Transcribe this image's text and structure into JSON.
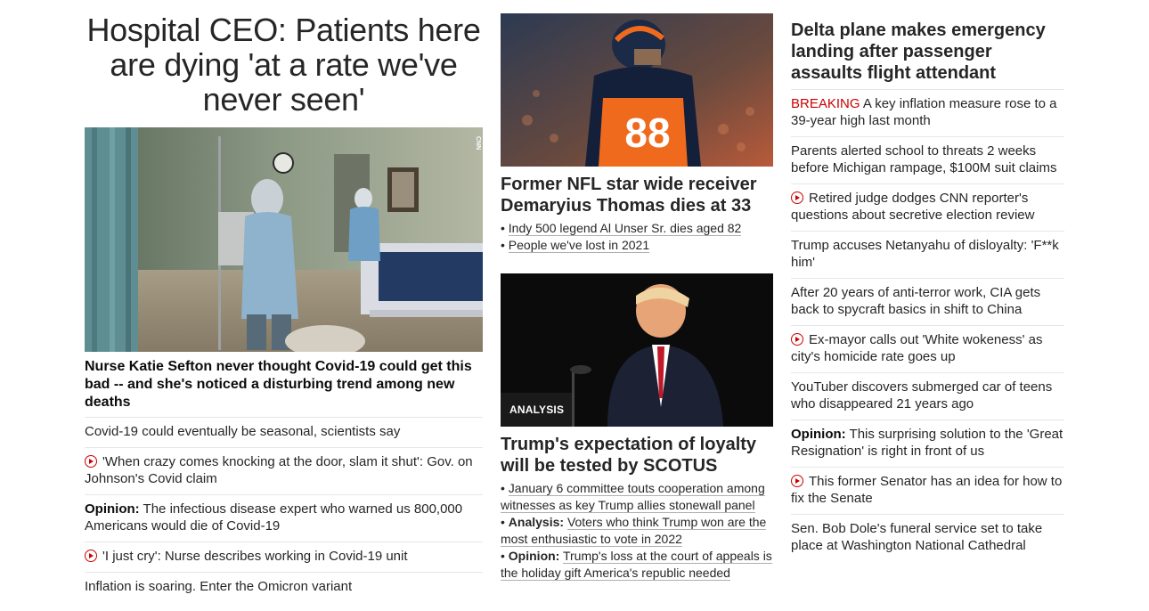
{
  "hero": {
    "title": "Hospital CEO: Patients here are dying 'at a rate we've never seen'",
    "watermark": "CNN",
    "caption": "Nurse Katie Sefton never thought Covid-19 could get this bad -- and she's noticed a disturbing trend among new deaths"
  },
  "col1_list": [
    {
      "video": false,
      "prefix": "",
      "text": "Covid-19 could eventually be seasonal, scientists say"
    },
    {
      "video": true,
      "prefix": "",
      "text": "'When crazy comes knocking at the door, slam it shut': Gov. on Johnson's Covid claim"
    },
    {
      "video": false,
      "prefix": "Opinion:",
      "text": " The infectious disease expert who warned us 800,000 Americans would die of Covid-19"
    },
    {
      "video": true,
      "prefix": "",
      "text": "'I just cry': Nurse describes working in Covid-19 unit"
    },
    {
      "video": false,
      "prefix": "",
      "text": "Inflation is soaring. Enter the Omicron variant"
    }
  ],
  "nfl": {
    "title": "Former NFL star wide receiver Demaryius Thomas dies at 33",
    "jersey_number": "88",
    "bullets": [
      "Indy 500 legend Al Unser Sr. dies aged 82",
      "People we've lost in 2021"
    ]
  },
  "trump": {
    "badge": "ANALYSIS",
    "title": "Trump's expectation of loyalty will be tested by SCOTUS",
    "bullets": [
      {
        "prefix": "",
        "text": "January 6 committee touts cooperation among witnesses as key Trump allies stonewall panel"
      },
      {
        "prefix": "Analysis:",
        "text": "Voters who think Trump won are the most enthusiastic to vote in 2022"
      },
      {
        "prefix": "Opinion:",
        "text": "Trump's loss at the court of appeals is the holiday gift America's republic needed"
      }
    ]
  },
  "col3": {
    "title": "Delta plane makes emergency landing after passenger assaults flight attendant",
    "items": [
      {
        "video": false,
        "prefix": "",
        "breaking": "BREAKING",
        "text": " A key inflation measure rose to a 39-year high last month"
      },
      {
        "video": false,
        "prefix": "",
        "breaking": "",
        "text": "Parents alerted school to threats 2 weeks before Michigan rampage, $100M suit claims"
      },
      {
        "video": true,
        "prefix": "",
        "breaking": "",
        "text": "Retired judge dodges CNN reporter's questions about secretive election review"
      },
      {
        "video": false,
        "prefix": "",
        "breaking": "",
        "text": "Trump accuses Netanyahu of disloyalty: 'F**k him'"
      },
      {
        "video": false,
        "prefix": "",
        "breaking": "",
        "text": "After 20 years of anti-terror work, CIA gets back to spycraft basics in shift to China"
      },
      {
        "video": true,
        "prefix": "",
        "breaking": "",
        "text": "Ex-mayor calls out 'White wokeness' as city's homicide rate goes up"
      },
      {
        "video": false,
        "prefix": "",
        "breaking": "",
        "text": "YouTuber discovers submerged car of teens who disappeared 21 years ago"
      },
      {
        "video": false,
        "prefix": "Opinion:",
        "breaking": "",
        "text": " This surprising solution to the 'Great Resignation' is right in front of us"
      },
      {
        "video": true,
        "prefix": "",
        "breaking": "",
        "text": "This former Senator has an idea for how to fix the Senate"
      },
      {
        "video": false,
        "prefix": "",
        "breaking": "",
        "text": "Sen. Bob Dole's funeral service set to take place at Washington National Cathedral"
      }
    ]
  },
  "colors": {
    "accent_red": "#cc0000",
    "text": "#262626",
    "divider": "#e6e6e6"
  }
}
